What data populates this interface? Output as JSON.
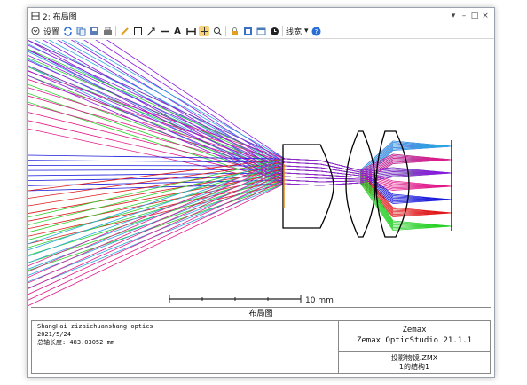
{
  "window": {
    "title": "2: 布局图",
    "controls": [
      "▾",
      "–",
      "□",
      "×"
    ]
  },
  "toolbar": {
    "settings_label": "设置",
    "linewidth_label": "线宽",
    "icons": [
      "refresh-icon",
      "copy-icon",
      "save-icon",
      "print-icon",
      "pencil-icon",
      "rectangle-icon",
      "arrow-icon",
      "line-icon",
      "text-icon",
      "dimension-icon",
      "pan-icon",
      "zoom-icon",
      "lock-icon",
      "fit-icon",
      "window-icon",
      "clock-icon",
      "help-icon"
    ]
  },
  "plot": {
    "scale_label": "10 mm",
    "caption": "布局图"
  },
  "info": {
    "company": "ShangHai zizaichuanshang optics",
    "date": "2021/5/24",
    "total_length": "总轴长度:  483.03052 mm",
    "vendor": "Zemax",
    "product": "Zemax OpticStudio 21.1.1",
    "file": "投影物镜.ZMX",
    "config": "1的结构1"
  },
  "colors": {
    "ray_colors": [
      "#1a1adb",
      "#2aa7e0",
      "#2bd12b",
      "#e01a8a",
      "#e0191a",
      "#8b1ae0"
    ],
    "lens_stroke": "#000000",
    "stop_color": "#f08c1a"
  }
}
